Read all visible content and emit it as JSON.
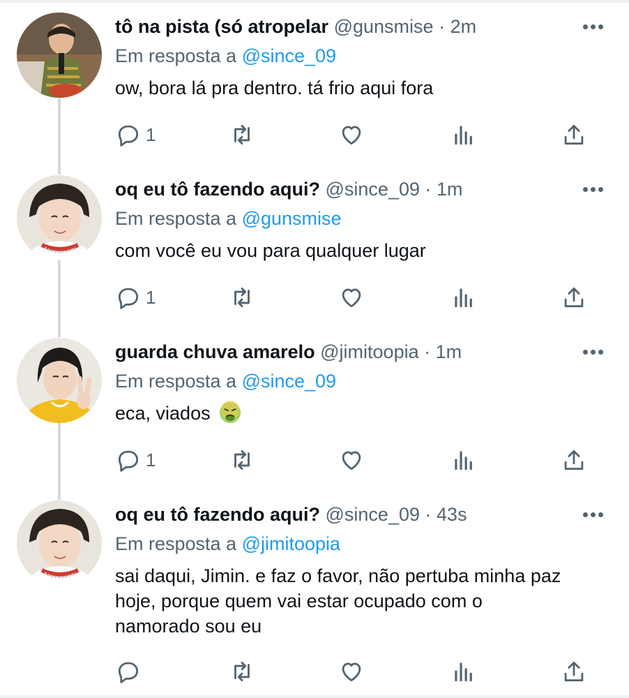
{
  "tweets": [
    {
      "name": "tô na pista (só atropelar",
      "handle": "@gunsmise",
      "time": "2m",
      "reply_prefix": "Em resposta a",
      "reply_to": "@since_09",
      "text": "ow, bora lá pra dentro. tá frio aqui fora",
      "reply_count": "1",
      "avatar": "avatar-gunsmise"
    },
    {
      "name": "oq eu tô fazendo aqui?",
      "handle": "@since_09",
      "time": "1m",
      "reply_prefix": "Em resposta a",
      "reply_to": "@gunsmise",
      "text": "com você eu vou para qualquer lugar",
      "reply_count": "1",
      "avatar": "avatar-since09"
    },
    {
      "name": "guarda chuva amarelo",
      "handle": "@jimitoopia",
      "time": "1m",
      "reply_prefix": "Em resposta a",
      "reply_to": "@since_09",
      "text": "eca, viados",
      "emoji": "nauseated-face-icon",
      "reply_count": "1",
      "avatar": "avatar-jimitoopia"
    },
    {
      "name": "oq eu tô fazendo aqui?",
      "handle": "@since_09",
      "time": "43s",
      "reply_prefix": "Em resposta a",
      "reply_to": "@jimitoopia",
      "text_lines": [
        "sai daqui, Jimin. e faz o favor, não pertuba minha paz",
        "hoje, porque quem vai estar ocupado com o",
        "namorado sou eu"
      ],
      "reply_count": "",
      "avatar": "avatar-since09"
    }
  ],
  "separator": "·",
  "icons": {
    "reply": "reply-icon",
    "retweet": "retweet-icon",
    "like": "heart-icon",
    "analytics": "analytics-icon",
    "share": "share-icon",
    "more": "more-icon"
  },
  "colors": {
    "link": "#1d9bf0",
    "secondary_text": "#536471",
    "thread_line": "#cfd9de"
  }
}
